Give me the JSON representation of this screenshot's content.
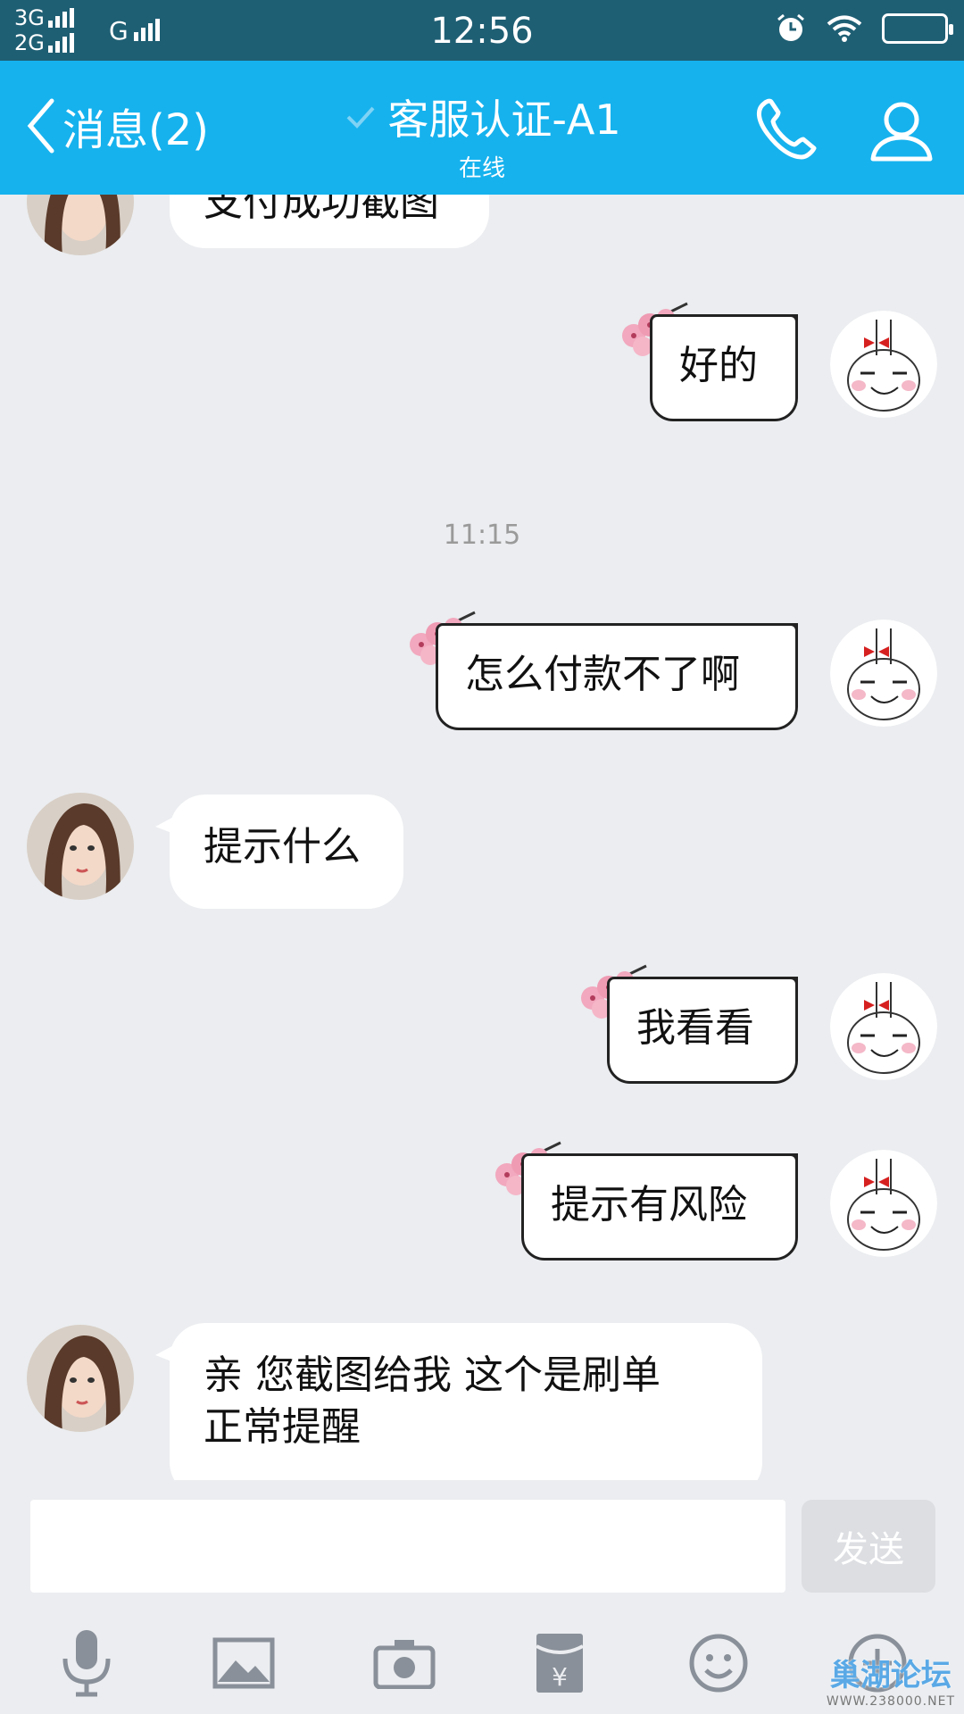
{
  "status_bar": {
    "network_1": "3G",
    "network_2": "2G",
    "network_3": "G",
    "time": "12:56",
    "icons": [
      "alarm-icon",
      "wifi-icon",
      "battery-icon"
    ]
  },
  "header": {
    "back_label": "消息(2)",
    "title": "客服认证-A1",
    "status": "在线",
    "background_color": "#16b2ee"
  },
  "chat": {
    "partial_message": "支付成功截图",
    "messages": [
      {
        "side": "right",
        "text": "好的"
      },
      {
        "timestamp": "11:15"
      },
      {
        "side": "right",
        "text": "怎么付款不了啊"
      },
      {
        "side": "left",
        "text": "提示什么"
      },
      {
        "side": "right",
        "text": "我看看"
      },
      {
        "side": "right",
        "text": "提示有风险"
      },
      {
        "side": "left",
        "text": "亲 您截图给我  这个是刷单正常提醒"
      }
    ],
    "msg0": "好的",
    "timestamp": "11:15",
    "msg1": "怎么付款不了啊",
    "msg2": "提示什么",
    "msg3": "我看看",
    "msg4": "提示有风险",
    "msg5_line1": "亲 您截图给我  这个是刷单",
    "msg5_line2": "正常提醒"
  },
  "input": {
    "value": "",
    "send_label": "发送"
  },
  "toolbar": {
    "items": [
      "microphone-icon",
      "image-icon",
      "camera-icon",
      "red-packet-icon",
      "emoji-icon",
      "plus-icon"
    ]
  },
  "watermark": {
    "title": "巢湖论坛",
    "url": "WWW.238000.NET"
  }
}
